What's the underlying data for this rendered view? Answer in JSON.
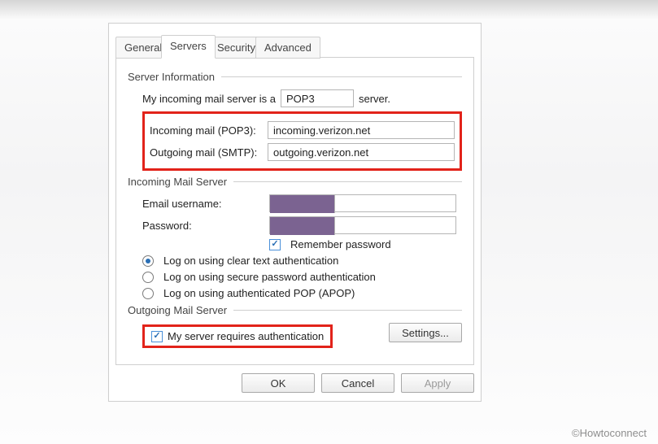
{
  "watermark": "©Howtoconnect",
  "tabs": {
    "general": "General",
    "servers": "Servers",
    "security": "Security",
    "advanced": "Advanced"
  },
  "server_info": {
    "legend": "Server Information",
    "line1_pre": "My incoming mail server is a",
    "protocol": "POP3",
    "line1_post": "server.",
    "incoming_label": "Incoming mail (POP3):",
    "incoming_value": "incoming.verizon.net",
    "outgoing_label": "Outgoing mail (SMTP):",
    "outgoing_value": "outgoing.verizon.net"
  },
  "incoming_server": {
    "legend": "Incoming Mail Server",
    "username_label": "Email username:",
    "username_value": "",
    "password_label": "Password:",
    "password_value": "",
    "remember_label": "Remember password",
    "auth_clear": "Log on using clear text authentication",
    "auth_secure": "Log on using secure password authentication",
    "auth_apop": "Log on using authenticated POP (APOP)"
  },
  "outgoing_server": {
    "legend": "Outgoing Mail Server",
    "requires_auth_label": "My server requires authentication",
    "settings_btn": "Settings..."
  },
  "buttons": {
    "ok": "OK",
    "cancel": "Cancel",
    "apply": "Apply"
  }
}
